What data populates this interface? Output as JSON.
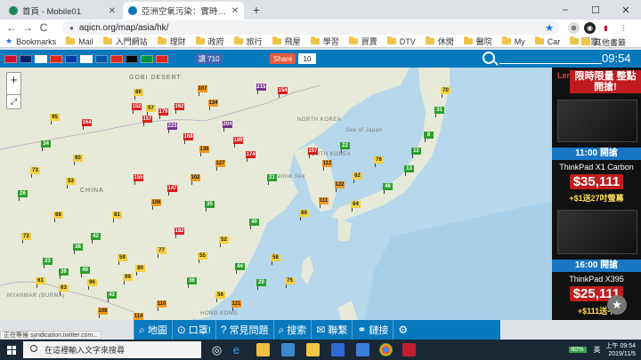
{
  "browser": {
    "tabs": [
      {
        "title": "首頁 - Mobile01",
        "close": "✕",
        "favicon_color": "#1b8a5a"
      },
      {
        "title": "亞洲空氣污染：實時空氣質量指數",
        "close": "✕",
        "favicon_color": "#0979bd"
      }
    ],
    "new_tab": "+",
    "window_controls": {
      "minimize": "–",
      "maximize": "☐",
      "close": "✕"
    },
    "url": "aqicn.org/map/asia/hk/",
    "nav": {
      "back": "←",
      "forward": "→",
      "reload": "C"
    },
    "bookmarks_label": "Bookmarks",
    "bookmarks": [
      "Mail",
      "入門網站",
      "理財",
      "政府",
      "旅行",
      "飛屋",
      "學習",
      "買賣",
      "DTV",
      "休閒",
      "醫院",
      "My",
      "Car",
      "居家"
    ],
    "other_bookmarks": "其他書籤"
  },
  "site": {
    "flags": [
      "#c8102e",
      "#012169",
      "#ffffff",
      "#de2910",
      "#003da5",
      "#ffffff",
      "#0055a4",
      "#d52b1e",
      "#000000",
      "#009246",
      "#da251d"
    ],
    "fb_like_label": "讚 710",
    "share_label": "Share",
    "share_count": "10",
    "time": "09:54"
  },
  "map": {
    "labels": {
      "gobi": "GOBI DESERT",
      "china": "CHINA",
      "north_korea": "NORTH KOREA",
      "south_korea": "SOUTH KOREA",
      "myanmar": "MYANMAR (BURMA)",
      "hong_kong": "HONG KONG",
      "japan_sea": "Sea of Japan",
      "yellow_sea": "Yellow Sea"
    },
    "zoom_in": "+",
    "zoom_out": "–",
    "fullscreen": "⤢",
    "markers": [
      {
        "v": "97",
        "c": "#f4d03f"
      },
      {
        "v": "34",
        "c": "#2ca02c"
      },
      {
        "v": "164",
        "c": "#d81e1e"
      },
      {
        "v": "86",
        "c": "#f4d03f"
      },
      {
        "v": "57",
        "c": "#f4d03f"
      },
      {
        "v": "152",
        "c": "#d81e1e"
      },
      {
        "v": "157",
        "c": "#d81e1e"
      },
      {
        "v": "179",
        "c": "#d81e1e"
      },
      {
        "v": "162",
        "c": "#d81e1e"
      },
      {
        "v": "107",
        "c": "#f09a23"
      },
      {
        "v": "134",
        "c": "#f09a23"
      },
      {
        "v": "215",
        "c": "#7b2d8e"
      },
      {
        "v": "154",
        "c": "#d81e1e"
      },
      {
        "v": "204",
        "c": "#7b2d8e"
      },
      {
        "v": "223",
        "c": "#7b2d8e"
      },
      {
        "v": "168",
        "c": "#d81e1e"
      },
      {
        "v": "136",
        "c": "#f09a23"
      },
      {
        "v": "189",
        "c": "#d81e1e"
      },
      {
        "v": "174",
        "c": "#d81e1e"
      },
      {
        "v": "127",
        "c": "#f09a23"
      },
      {
        "v": "73",
        "c": "#f4d03f"
      },
      {
        "v": "85",
        "c": "#f4d03f"
      },
      {
        "v": "53",
        "c": "#f4d03f"
      },
      {
        "v": "26",
        "c": "#2ca02c"
      },
      {
        "v": "68",
        "c": "#f4d03f"
      },
      {
        "v": "155",
        "c": "#d81e1e"
      },
      {
        "v": "72",
        "c": "#f4d03f"
      },
      {
        "v": "42",
        "c": "#2ca02c"
      },
      {
        "v": "38",
        "c": "#2ca02c"
      },
      {
        "v": "23",
        "c": "#2ca02c"
      },
      {
        "v": "39",
        "c": "#2ca02c"
      },
      {
        "v": "81",
        "c": "#f4d03f"
      },
      {
        "v": "106",
        "c": "#f09a23"
      },
      {
        "v": "147",
        "c": "#d81e1e"
      },
      {
        "v": "102",
        "c": "#f09a23"
      },
      {
        "v": "59",
        "c": "#f4d03f"
      },
      {
        "v": "182",
        "c": "#d81e1e"
      },
      {
        "v": "99",
        "c": "#f4d03f"
      },
      {
        "v": "96",
        "c": "#f4d03f"
      },
      {
        "v": "49",
        "c": "#2ca02c"
      },
      {
        "v": "63",
        "c": "#f4d03f"
      },
      {
        "v": "61",
        "c": "#f4d03f"
      },
      {
        "v": "43",
        "c": "#2ca02c"
      },
      {
        "v": "80",
        "c": "#f4d03f"
      },
      {
        "v": "77",
        "c": "#f4d03f"
      },
      {
        "v": "52",
        "c": "#f4d03f"
      },
      {
        "v": "55",
        "c": "#f4d03f"
      },
      {
        "v": "44",
        "c": "#2ca02c"
      },
      {
        "v": "29",
        "c": "#2ca02c"
      },
      {
        "v": "56",
        "c": "#f4d03f"
      },
      {
        "v": "75",
        "c": "#f4d03f"
      },
      {
        "v": "58",
        "c": "#f4d03f"
      },
      {
        "v": "89",
        "c": "#f4d03f"
      },
      {
        "v": "111",
        "c": "#f09a23"
      },
      {
        "v": "122",
        "c": "#f09a23"
      },
      {
        "v": "112",
        "c": "#f09a23"
      },
      {
        "v": "157",
        "c": "#d81e1e"
      },
      {
        "v": "64",
        "c": "#f4d03f"
      },
      {
        "v": "46",
        "c": "#2ca02c"
      },
      {
        "v": "13",
        "c": "#2ca02c"
      },
      {
        "v": "12",
        "c": "#2ca02c"
      },
      {
        "v": "8",
        "c": "#2ca02c"
      },
      {
        "v": "31",
        "c": "#2ca02c"
      },
      {
        "v": "70",
        "c": "#f4d03f"
      },
      {
        "v": "76",
        "c": "#f4d03f"
      },
      {
        "v": "62",
        "c": "#f4d03f"
      },
      {
        "v": "22",
        "c": "#2ca02c"
      },
      {
        "v": "21",
        "c": "#2ca02c"
      },
      {
        "v": "35",
        "c": "#2ca02c"
      },
      {
        "v": "40",
        "c": "#2ca02c"
      },
      {
        "v": "36",
        "c": "#2ca02c"
      },
      {
        "v": "110",
        "c": "#f09a23"
      },
      {
        "v": "121",
        "c": "#f09a23"
      },
      {
        "v": "114",
        "c": "#f09a23"
      },
      {
        "v": "108",
        "c": "#f09a23"
      },
      {
        "v": "95",
        "c": "#f4d03f"
      }
    ]
  },
  "ad": {
    "brand": "Leno",
    "headline": "限時限量 整點開搶!",
    "slot1_time": "11:00 開搶",
    "slot1_model": "ThinkPad X1 Carbon",
    "slot1_price": "$35,111",
    "slot1_gift": "+$1送27吋螢幕",
    "slot2_time": "16:00 開搶",
    "slot2_model": "ThinkPad X395",
    "slot2_price": "$25,111",
    "slot2_gift": "+$111送平",
    "fab": "★"
  },
  "bottom_menu": [
    {
      "icon": "⌕",
      "label": "地圖"
    },
    {
      "icon": "⊙",
      "label": "口罩!"
    },
    {
      "icon": "?",
      "label": "常見問題"
    },
    {
      "icon": "⌕",
      "label": "搜索"
    },
    {
      "icon": "✉",
      "label": "聯繫"
    },
    {
      "icon": "⚭",
      "label": "鏈接"
    },
    {
      "icon": "⚙",
      "label": ""
    }
  ],
  "status_text": "正在等候 syndication.twitter.com...",
  "taskbar": {
    "search_placeholder": "在這裡輸入文字來搜尋",
    "battery": "80%",
    "ime": "英",
    "time": "上午 09:54",
    "date": "2019/11/5"
  }
}
